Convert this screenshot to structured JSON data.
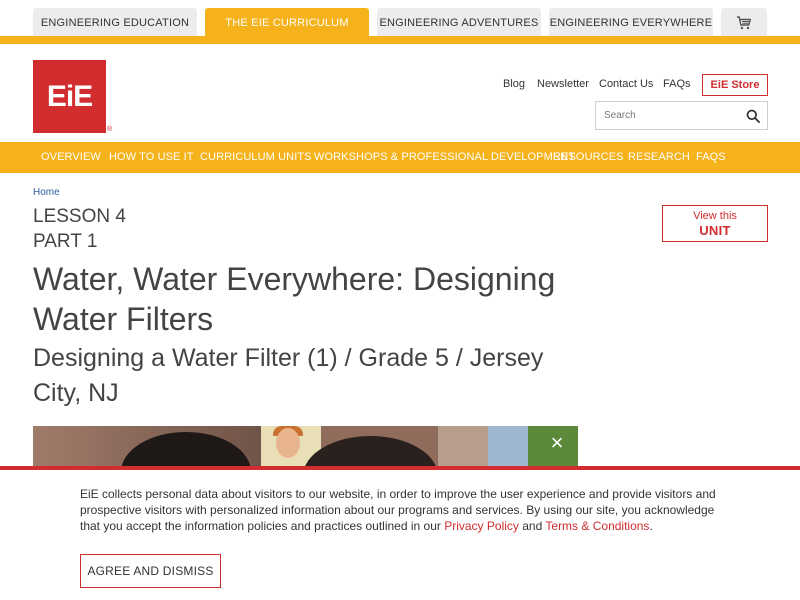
{
  "top_tabs": [
    {
      "label": "ENGINEERING EDUCATION",
      "active": false
    },
    {
      "label": "THE EIE CURRICULUM",
      "active": true
    },
    {
      "label": "ENGINEERING ADVENTURES",
      "active": false
    },
    {
      "label": "ENGINEERING EVERYWHERE",
      "active": false
    }
  ],
  "logo": {
    "text": "EiE",
    "mark": "®"
  },
  "utility": {
    "blog": "Blog",
    "newsletter": "Newsletter",
    "contact": "Contact Us",
    "faqs": "FAQs",
    "store": "EiE Store"
  },
  "search": {
    "placeholder": "Search"
  },
  "nav": [
    "OVERVIEW",
    "HOW TO USE IT",
    "CURRICULUM UNITS",
    "WORKSHOPS & PROFESSIONAL DEVELOPMENT",
    "RESOURCES",
    "RESEARCH",
    "FAQS"
  ],
  "breadcrumb": "Home",
  "lesson": {
    "lesson_label": "LESSON 4",
    "part_label": "PART 1",
    "title": "Water, Water Everywhere: Designing Water Filters",
    "subtitle": "Designing a Water Filter (1) / Grade 5 / Jersey City, NJ"
  },
  "view_unit": {
    "line1": "View this",
    "line2": "UNIT"
  },
  "video": {
    "close": "×"
  },
  "cookie": {
    "text_before": "EiE collects personal data about visitors to our website, in order to improve the user experience and provide visitors and prospective visitors with personalized information about our programs and services. By using our site, you acknowledge that you accept the information policies and practices outlined in our ",
    "privacy_link": "Privacy Policy",
    "and": " and ",
    "terms_link": "Terms & Conditions",
    "period": ".",
    "button": "AGREE AND DISMISS"
  },
  "colors": {
    "accent_yellow": "#f6b21a",
    "brand_red": "#d12c2e"
  }
}
